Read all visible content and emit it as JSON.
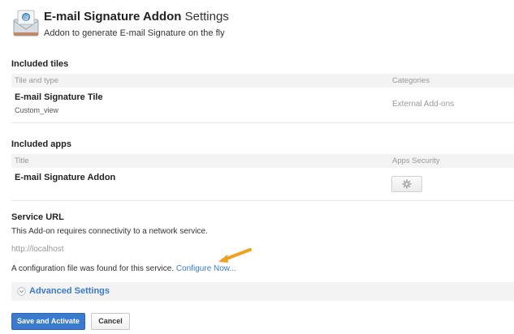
{
  "header": {
    "title_bold": "E-mail Signature Addon",
    "title_light": "Settings",
    "subtitle": "Addon to generate E-mail Signature on the fly",
    "icon": "envelope-icon"
  },
  "tiles": {
    "section_title": "Included tiles",
    "columns": [
      "Tile and type",
      "Categories"
    ],
    "rows": [
      {
        "name": "E-mail Signature Tile",
        "type": "Custom_view",
        "category": "External Add-ons"
      }
    ]
  },
  "apps": {
    "section_title": "Included apps",
    "columns": [
      "Title",
      "Apps Security"
    ],
    "rows": [
      {
        "name": "E-mail Signature Addon",
        "security_icon": "gear-icon"
      }
    ]
  },
  "service": {
    "section_title": "Service URL",
    "description": "This Add-on requires connectivity to a network service.",
    "url": "http://localhost",
    "config_text": "A configuration file was found for this service.",
    "config_link": "Configure Now..."
  },
  "advanced": {
    "label": "Advanced Settings"
  },
  "buttons": {
    "save": "Save and Activate",
    "cancel": "Cancel"
  },
  "colors": {
    "accent": "#3a7bd0",
    "link": "#3a7bc8",
    "arrow": "#f0a020"
  }
}
